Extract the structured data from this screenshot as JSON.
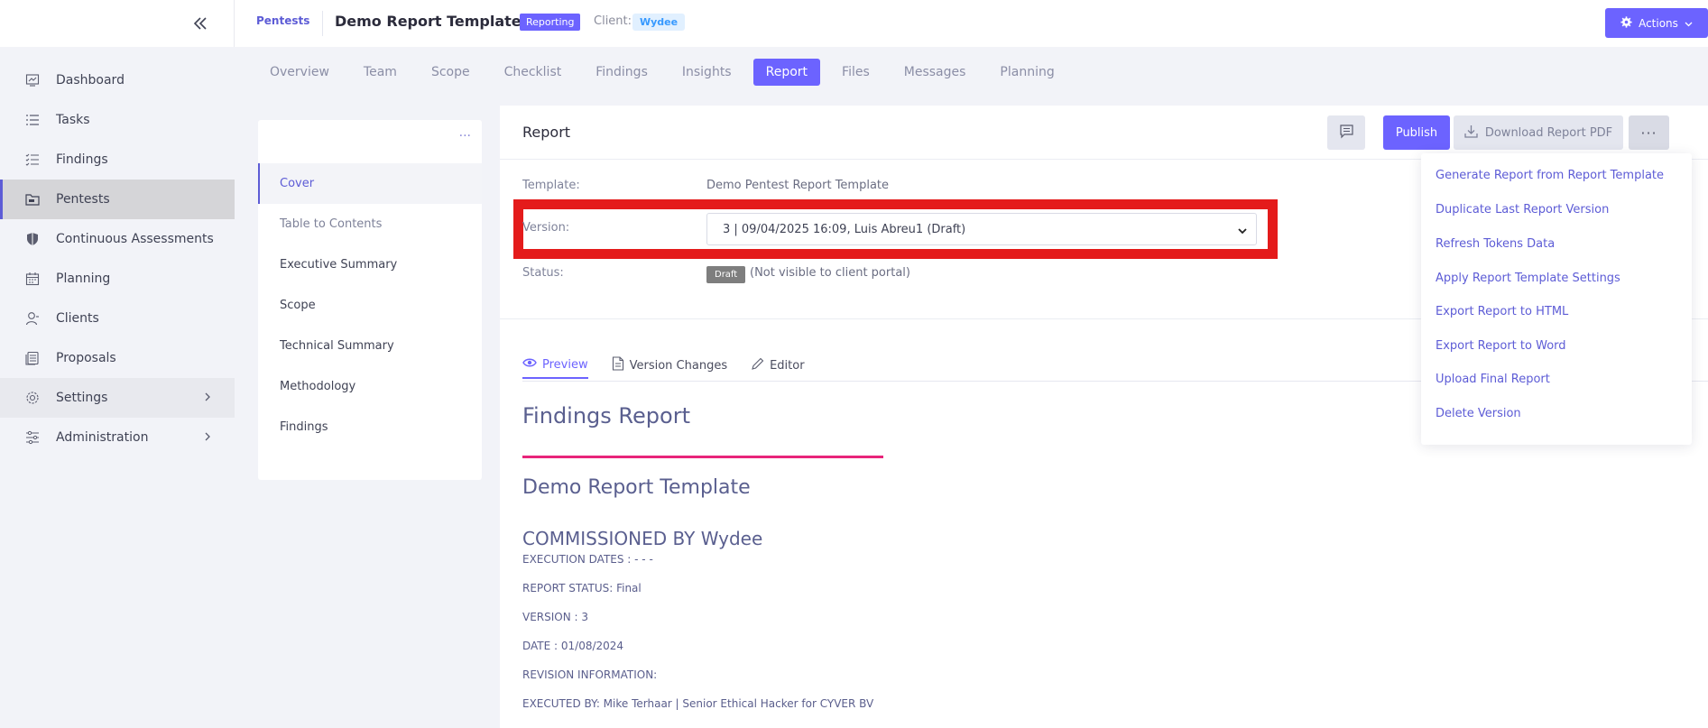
{
  "header": {
    "breadcrumb": "Pentests",
    "title": "Demo Report Template",
    "status_badge": "Reporting",
    "client_label": "Client:",
    "client_name": "Wydee",
    "actions_label": "Actions"
  },
  "sidebar": {
    "items": [
      {
        "label": "Dashboard",
        "icon": "chart-icon"
      },
      {
        "label": "Tasks",
        "icon": "list-icon"
      },
      {
        "label": "Findings",
        "icon": "checklist-icon"
      },
      {
        "label": "Pentests",
        "icon": "folder-icon",
        "active": true
      },
      {
        "label": "Continuous Assessments",
        "icon": "shield-icon"
      },
      {
        "label": "Planning",
        "icon": "calendar-icon"
      },
      {
        "label": "Clients",
        "icon": "user-icon"
      },
      {
        "label": "Proposals",
        "icon": "stack-icon"
      },
      {
        "label": "Settings",
        "icon": "gear-icon",
        "has_children": true
      },
      {
        "label": "Administration",
        "icon": "sliders-icon",
        "has_children": true
      }
    ]
  },
  "tabs": [
    "Overview",
    "Team",
    "Scope",
    "Checklist",
    "Findings",
    "Insights",
    "Report",
    "Files",
    "Messages",
    "Planning"
  ],
  "active_tab": "Report",
  "report_nav": {
    "items": [
      "Cover",
      "Table to Contents",
      "Executive Summary",
      "Scope",
      "Technical Summary",
      "Methodology",
      "Findings"
    ],
    "active": "Cover"
  },
  "report": {
    "title": "Report",
    "publish_label": "Publish",
    "download_label": "Download Report PDF",
    "more_label": "···",
    "template_label": "Template:",
    "template_value": "Demo Pentest Report Template",
    "version_label": "Version:",
    "version_value": "3 | 09/04/2025 16:09, Luis Abreu1 (Draft)",
    "status_label": "Status:",
    "status_badge": "Draft",
    "status_note": "(Not visible to client portal)"
  },
  "sub_tabs": [
    {
      "label": "Preview",
      "icon": "eye-icon",
      "active": true
    },
    {
      "label": "Version Changes",
      "icon": "document-icon"
    },
    {
      "label": "Editor",
      "icon": "pencil-icon"
    }
  ],
  "preview": {
    "h1": "Findings Report",
    "h2": "Demo Report Template",
    "h3": "COMMISSIONED BY Wydee",
    "lines": [
      "EXECUTION DATES : - - -",
      "REPORT STATUS: Final",
      "VERSION : 3",
      "DATE : 01/08/2024",
      "REVISION INFORMATION:",
      "EXECUTED BY: Mike Terhaar | Senior Ethical Hacker for CYVER BV"
    ]
  },
  "dropdown": {
    "items": [
      "Generate Report from Report Template",
      "Duplicate Last Report Version",
      "Refresh Tokens Data",
      "Apply Report Template Settings",
      "Export Report to HTML",
      "Export Report to Word",
      "Upload Final Report",
      "Delete Version"
    ]
  },
  "colors": {
    "accent": "#6c63ff",
    "highlight_box": "#e41b1b",
    "rule": "#e8247a"
  }
}
